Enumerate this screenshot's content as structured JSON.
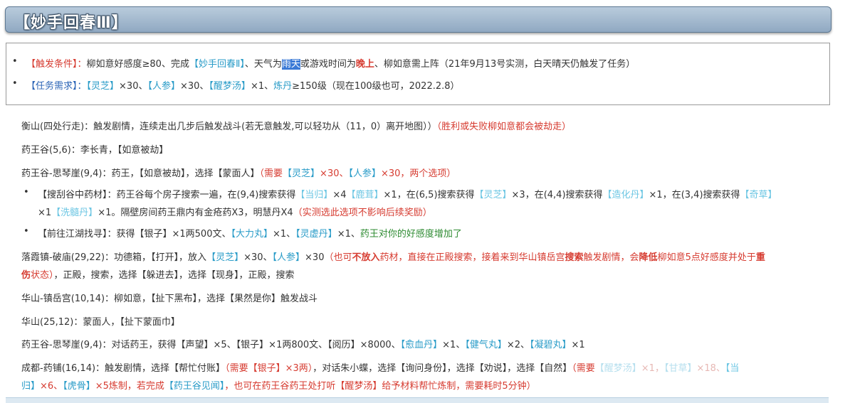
{
  "title": "【妙手回春Ⅲ】",
  "trigger": {
    "label": "【触发条件】：",
    "t1": "柳如意好感度≥80、完成",
    "quest": "【妙手回春Ⅱ】",
    "t2": "、天气为",
    "rain_sel": "雨天",
    "t3": "或游戏时间为",
    "night": "晚上",
    "t4": "、柳如意需上阵（21年9月13号实测，白天晴天仍触发了任务）"
  },
  "requirement": {
    "label": "【任务需求】：",
    "item1": "【灵芝】",
    "q1": "×30、",
    "item2": "【人参】",
    "q2": "×30、",
    "item3": "【醒梦汤】",
    "q3": "×1、",
    "level": "炼丹",
    "t_end": "≥150级（现在100级也可，2022.2.8）"
  },
  "lines": {
    "l1a": "衡山(四处行走)：触发剧情，连续走出几步后触发战斗(若无意触发,可以轻功从（11，0）离开地图））",
    "l1b": "（胜利或失败柳如意都会被劫走）",
    "l2": "药王谷(5,6)：李长青，【如意被劫】",
    "l3a": "药王谷-思琴崖(9,4)：药王，【如意被劫】，选择【蒙面人】",
    "l3b": "（需要",
    "l3c": "【灵芝】",
    "l3d": "×30、",
    "l3e": "【人参】",
    "l3f": "×30，两个选项）",
    "s1a": "【搜刮谷中药材】：药王谷每个房子搜索一遍，在(9,4)搜索获得",
    "s1b": "【当归】",
    "s1c": "×4",
    "s1d": "【鹿茸】",
    "s1e": "×1，在(6,5)搜索获得",
    "s1f": "【灵芝】",
    "s1g": "×3，在(4,4)搜索获得",
    "s1h": "【造化丹】",
    "s1i": "×1，在(3,4)搜索获得",
    "s1j": "【奇草】",
    "s1k": "×1",
    "s1l": "【洗髓丹】",
    "s1m": "×1。隔壁房间药王鼎内有金疮药X3，明慧丹X4",
    "s1n": "（实测选此选项不影响后续奖励）",
    "s2a": "【前往江湖找寻】：获得【银子】×1两500文、",
    "s2b": "【大力丸】",
    "s2c": "×1、",
    "s2d": "【灵虚丹】",
    "s2e": "×1、",
    "s2f": "药王对你的好感度增加了",
    "l4a": "落霞镇-破庙(29,22)：功德箱，【打开】，放入",
    "l4b": "【灵芝】",
    "l4c": "×30、",
    "l4d": "【人参】",
    "l4e": "×30",
    "l4f": "（也可",
    "l4g": "不放入",
    "l4h": "药材，直接在正殿搜索，接着来到华山镇岳宫",
    "l4i": "搜索",
    "l4j": "触发剧情，会",
    "l4k": "降低",
    "l4l": "柳如意5点好感度并处于",
    "l4m": "重",
    "l4n": "伤",
    "l4o": "状态）",
    "l4p": "，正殿，搜索，选择【躲进去】，选择【现身】，正殿，搜索",
    "l5": "华山-镇岳宫(10,14)：柳如意，【扯下黑布】，选择【果然是你】触发战斗",
    "l6": "华山(25,12)：蒙面人，【扯下蒙面巾】",
    "l7a": "药王谷-思琴崖(9,4)：对话药王，获得【声望】×5、【银子】×1两800文、【阅历】×8000、",
    "l7b": "【愈血丹】",
    "l7c": "×1、",
    "l7d": "【健气丸】",
    "l7e": "×2、",
    "l7f": "【凝碧丸】",
    "l7g": "×1",
    "l8a": "成都-药铺(16,14)：触发剧情，选择【帮忙付账】",
    "l8b": "（需要【银子】×3两）",
    "l8c": "，对话朱小蝶，选择【询问身份】，选择【劝说】，选择【自然】",
    "l8d": "（需要",
    "l8e": "【醒梦汤】",
    "l8f": "×1，",
    "l8g": "【甘草】",
    "l8h": "×18、",
    "l8i": "【当",
    "l8j": "归】",
    "l8k": "×6、",
    "l8l": "【虎骨】",
    "l8m": "×5炼制，若完成",
    "l8n": "【药王谷见闻】",
    "l8o": "，也可在药王谷药王处打听【醒梦汤】给予材料帮忙炼制，需要耗时5分钟）"
  }
}
